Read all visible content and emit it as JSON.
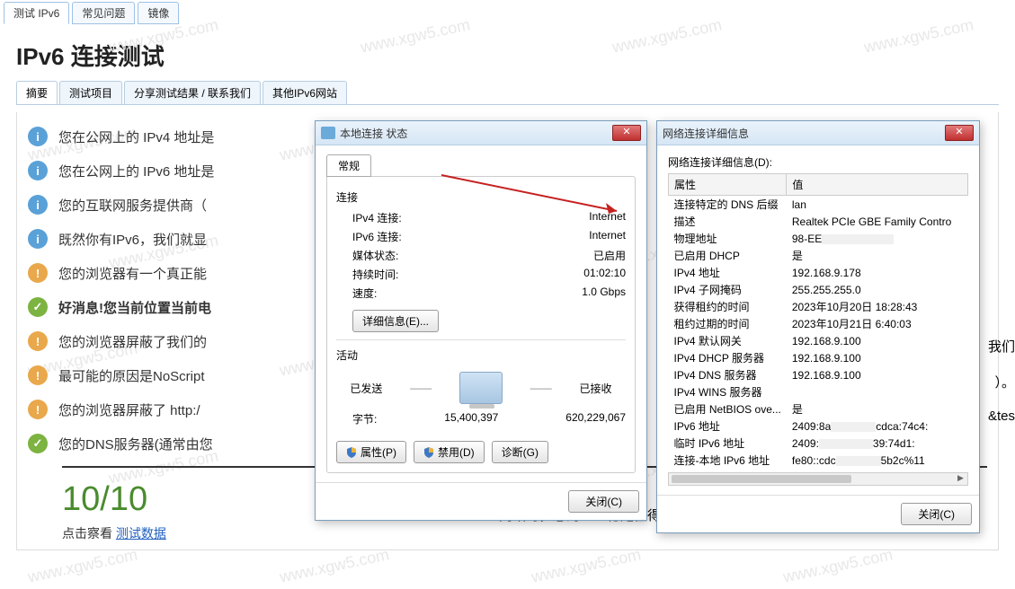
{
  "top_tabs": [
    "测试 IPv6",
    "常见问题",
    "镜像"
  ],
  "page_title": "IPv6 连接测试",
  "sub_tabs": [
    "摘要",
    "测试项目",
    "分享测试结果 / 联系我们",
    "其他IPv6网站"
  ],
  "results": {
    "l0": "您在公网上的 IPv4 地址是",
    "l1": "您在公网上的 IPv6 地址是",
    "l2": "您的互联网服务提供商（",
    "l3": "既然你有IPv6，我们就显",
    "l4": "您的浏览器有一个真正能",
    "l5": "好消息!您当前位置当前电",
    "l6": "您的浏览器屏蔽了我们的",
    "l7": "最可能的原因是NoScript",
    "l8": "您的浏览器屏蔽了 http:/",
    "l9": "您的DNS服务器(通常由您"
  },
  "right_fragment1": "我们",
  "right_fragment2": "）。",
  "right_fragment3": "&tes",
  "mid_fragment": "网站时，您的IPv6稳定性得分",
  "score": "10/10",
  "footer_text": "点击察看 ",
  "footer_link": "测试数据",
  "dialog1": {
    "title": "本地连接 状态",
    "tab": "常规",
    "section_conn": "连接",
    "rows": {
      "ipv4_lbl": "IPv4 连接:",
      "ipv4_val": "Internet",
      "ipv6_lbl": "IPv6 连接:",
      "ipv6_val": "Internet",
      "media_lbl": "媒体状态:",
      "media_val": "已启用",
      "dur_lbl": "持续时间:",
      "dur_val": "01:02:10",
      "speed_lbl": "速度:",
      "speed_val": "1.0 Gbps"
    },
    "detail_btn": "详细信息(E)...",
    "section_act": "活动",
    "sent_lbl": "已发送",
    "recv_lbl": "已接收",
    "bytes_lbl": "字节:",
    "bytes_sent": "15,400,397",
    "bytes_recv": "620,229,067",
    "btn_prop": "属性(P)",
    "btn_disable": "禁用(D)",
    "btn_diag": "诊断(G)",
    "btn_close": "关闭(C)"
  },
  "dialog2": {
    "title": "网络连接详细信息",
    "list_label": "网络连接详细信息(D):",
    "col_prop": "属性",
    "col_val": "值",
    "rows": [
      [
        "连接特定的 DNS 后缀",
        "lan"
      ],
      [
        "描述",
        "Realtek PCIe GBE Family Contro"
      ],
      [
        "物理地址",
        "98-EE"
      ],
      [
        "已启用 DHCP",
        "是"
      ],
      [
        "IPv4 地址",
        "192.168.9.178"
      ],
      [
        "IPv4 子网掩码",
        "255.255.255.0"
      ],
      [
        "获得租约的时间",
        "2023年10月20日 18:28:43"
      ],
      [
        "租约过期的时间",
        "2023年10月21日 6:40:03"
      ],
      [
        "IPv4 默认网关",
        "192.168.9.100"
      ],
      [
        "IPv4 DHCP 服务器",
        "192.168.9.100"
      ],
      [
        "IPv4 DNS 服务器",
        "192.168.9.100"
      ],
      [
        "IPv4 WINS 服务器",
        ""
      ],
      [
        "已启用 NetBIOS ove...",
        "是"
      ],
      [
        "IPv6 地址",
        "2409:8a"
      ],
      [
        "临时 IPv6 地址",
        "2409:"
      ],
      [
        "连接-本地 IPv6 地址",
        "fe80::cdc"
      ]
    ],
    "v6_tail1": "cdca:74c4:",
    "v6_tail2": "39:74d1:",
    "v6_tail3": "5b2c%11",
    "btn_close": "关闭(C)"
  },
  "watermark": "www.xgw5.com"
}
